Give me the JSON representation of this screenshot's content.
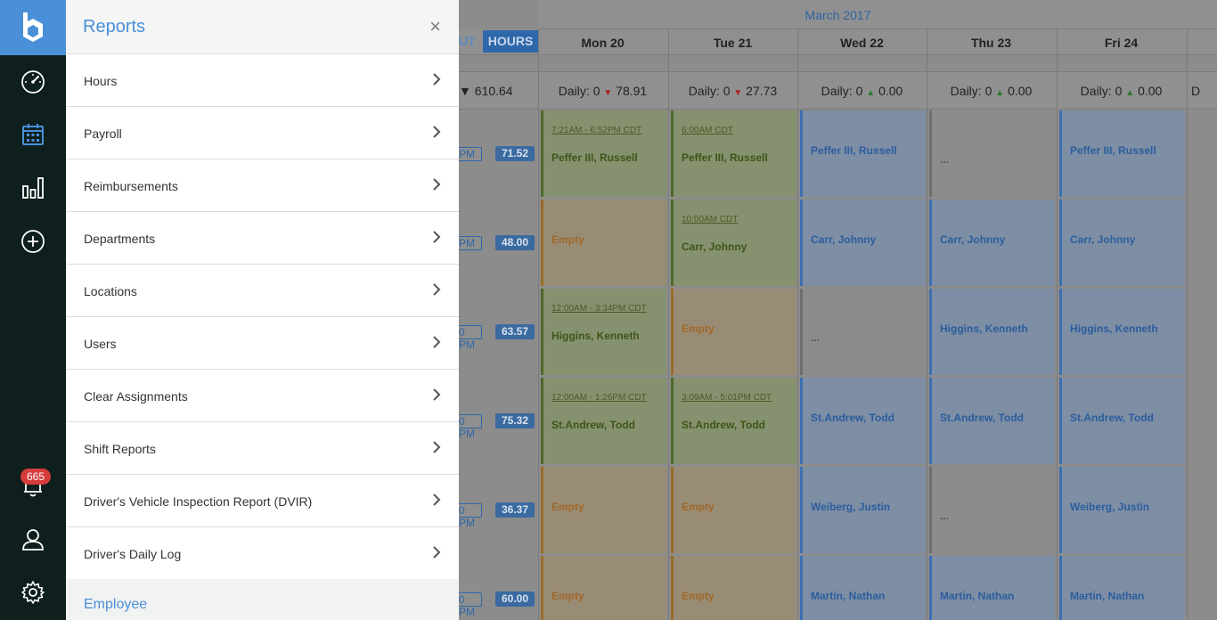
{
  "rail": {
    "badge_count": "665",
    "accent": "#4a90d9",
    "items": [
      "dashboard-icon",
      "calendar-icon",
      "bar-chart-icon",
      "add-circle-icon",
      "bell-icon",
      "user-icon",
      "gear-icon"
    ]
  },
  "panel": {
    "title": "Reports",
    "close_label": "×",
    "items": [
      {
        "label": "Hours"
      },
      {
        "label": "Payroll"
      },
      {
        "label": "Reimbursements"
      },
      {
        "label": "Departments"
      },
      {
        "label": "Locations"
      },
      {
        "label": "Users"
      },
      {
        "label": "Clear Assignments"
      },
      {
        "label": "Shift Reports"
      },
      {
        "label": "Driver's Vehicle Inspection Report (DVIR)"
      },
      {
        "label": "Driver's Daily Log"
      }
    ],
    "section": "Employee"
  },
  "schedule": {
    "month": "March 2017",
    "tab_ut": "UT",
    "tab_hours": "HOURS",
    "days": [
      "Mon 20",
      "Tue 21",
      "Wed 22",
      "Thu 23",
      "Fri 24"
    ],
    "total": "610.64",
    "daily": [
      {
        "label": "Daily:",
        "count": "0",
        "dir": "down",
        "value": "78.91"
      },
      {
        "label": "Daily:",
        "count": "0",
        "dir": "down",
        "value": "27.73"
      },
      {
        "label": "Daily:",
        "count": "0",
        "dir": "up",
        "value": "0.00"
      },
      {
        "label": "Daily:",
        "count": "0",
        "dir": "up",
        "value": "0.00"
      },
      {
        "label": "Daily:",
        "count": "0",
        "dir": "up",
        "value": "0.00"
      }
    ],
    "daily_partial": "D",
    "rows": [
      {
        "time_suffix": "PM",
        "hours": "71.52",
        "cells": [
          {
            "type": "green",
            "time": "7:21AM - 6:52PM CDT",
            "name": "Peffer III, Russell"
          },
          {
            "type": "green",
            "time": "6:00AM CDT",
            "name": "Peffer III, Russell"
          },
          {
            "type": "blue",
            "name": "Peffer III, Russell"
          },
          {
            "type": "grey",
            "name": "..."
          },
          {
            "type": "blue",
            "name": "Peffer III, Russell"
          }
        ]
      },
      {
        "time_suffix": "PM",
        "hours": "48.00",
        "cells": [
          {
            "type": "orange",
            "name": "Empty"
          },
          {
            "type": "green",
            "time": "10:00AM CDT",
            "name": "Carr, Johnny"
          },
          {
            "type": "blue",
            "name": "Carr, Johnny"
          },
          {
            "type": "blue",
            "name": "Carr, Johnny"
          },
          {
            "type": "blue",
            "name": "Carr, Johnny"
          }
        ]
      },
      {
        "time_suffix": "0 PM",
        "hours": "63.57",
        "cells": [
          {
            "type": "green",
            "time": "12:00AM - 3:34PM CDT",
            "name": "Higgins, Kenneth"
          },
          {
            "type": "orange",
            "name": "Empty"
          },
          {
            "type": "grey",
            "name": "..."
          },
          {
            "type": "blue",
            "name": "Higgins, Kenneth"
          },
          {
            "type": "blue",
            "name": "Higgins, Kenneth"
          }
        ]
      },
      {
        "time_suffix": "0 PM",
        "hours": "75.32",
        "cells": [
          {
            "type": "green",
            "time": "12:00AM - 1:26PM CDT",
            "name": "St.Andrew, Todd"
          },
          {
            "type": "green",
            "time": "3:09AM - 5:01PM CDT",
            "name": "St.Andrew, Todd"
          },
          {
            "type": "blue",
            "name": "St.Andrew, Todd"
          },
          {
            "type": "blue",
            "name": "St.Andrew, Todd"
          },
          {
            "type": "blue",
            "name": "St.Andrew, Todd"
          }
        ]
      },
      {
        "time_suffix": "0 PM",
        "hours": "36.37",
        "cells": [
          {
            "type": "orange",
            "name": "Empty"
          },
          {
            "type": "orange",
            "name": "Empty"
          },
          {
            "type": "blue",
            "name": "Weiberg, Justin"
          },
          {
            "type": "grey",
            "name": "..."
          },
          {
            "type": "blue",
            "name": "Weiberg, Justin"
          }
        ]
      },
      {
        "time_suffix": "0 PM",
        "hours": "60.00",
        "cells": [
          {
            "type": "orange",
            "name": "Empty"
          },
          {
            "type": "orange",
            "name": "Empty"
          },
          {
            "type": "blue",
            "name": "Martin, Nathan"
          },
          {
            "type": "blue",
            "name": "Martin, Nathan"
          },
          {
            "type": "blue",
            "name": "Martin, Nathan"
          }
        ]
      }
    ]
  }
}
